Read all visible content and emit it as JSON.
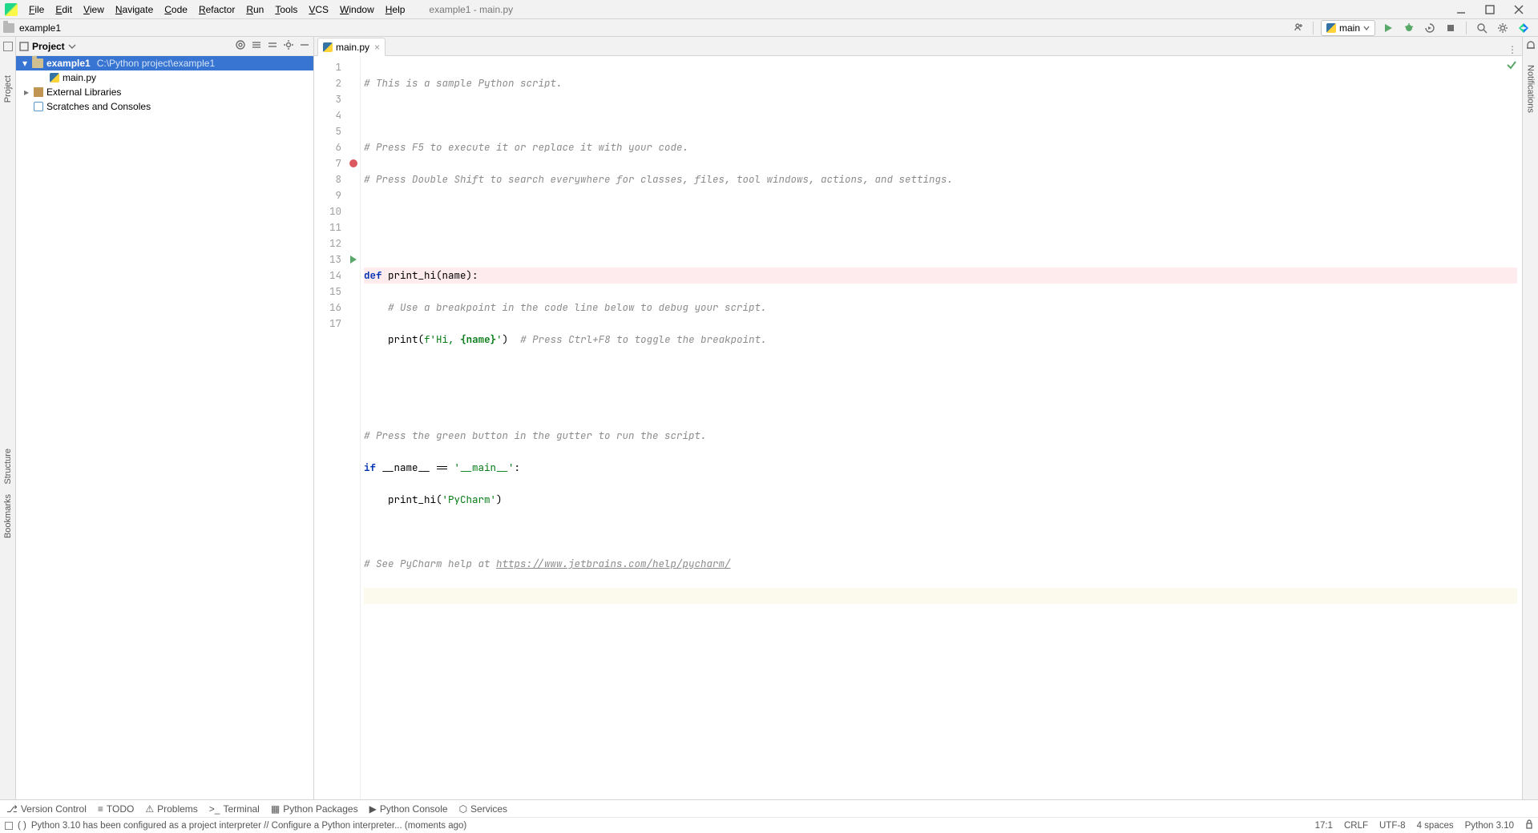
{
  "menu": [
    "File",
    "Edit",
    "View",
    "Navigate",
    "Code",
    "Refactor",
    "Run",
    "Tools",
    "VCS",
    "Window",
    "Help"
  ],
  "window_title": "example1 - main.py",
  "breadcrumb": "example1",
  "run_config": "main",
  "sidebar": {
    "project_label": "Project",
    "tree": {
      "root_name": "example1",
      "root_path": "C:\\Python project\\example1",
      "file": "main.py",
      "external": "External Libraries",
      "scratch": "Scratches and Consoles"
    }
  },
  "left_tool_buttons": [
    "Project",
    "Structure",
    "Bookmarks"
  ],
  "right_tool_buttons": [
    "Notifications"
  ],
  "tab": {
    "name": "main.py"
  },
  "code": {
    "c1": "# This is a sample Python script.",
    "c3": "# Press F5 to execute it or replace it with your code.",
    "c4": "# Press Double Shift to search everywhere for classes, files, tool windows, actions, and settings.",
    "kw_def": "def",
    "fn_def": " print_hi(name):",
    "c8": "# Use a breakpoint in the code line below to debug your script.",
    "l9_print": "print",
    "l9_open": "(",
    "l9_fprefix": "f'Hi, ",
    "l9_name": "{name}",
    "l9_close": "'",
    "l9_paren": ")",
    "l9_cm": "# Press Ctrl+F8 to toggle the breakpoint.",
    "c12": "# Press the green button in the gutter to run the script.",
    "kw_if": "if",
    "if_rest1": " __name__ == ",
    "if_str": "'__main__'",
    "if_rest2": ":",
    "l14_call": "print_hi(",
    "l14_str": "'PyCharm'",
    "l14_close": ")",
    "c16a": "# See PyCharm help at ",
    "c16b": "https://www.jetbrains.com/help/pycharm/"
  },
  "line_count": 17,
  "breakpoint_line": 7,
  "run_gutter_line": 13,
  "bottom_tools": [
    "Version Control",
    "TODO",
    "Problems",
    "Terminal",
    "Python Packages",
    "Python Console",
    "Services"
  ],
  "status_left": "Python 3.10 has been configured as a project interpreter // Configure a Python interpreter... (moments ago)",
  "status_right": {
    "pos": "17:1",
    "lineend": "CRLF",
    "encoding": "UTF-8",
    "indent": "4 spaces",
    "interp": "Python 3.10"
  }
}
